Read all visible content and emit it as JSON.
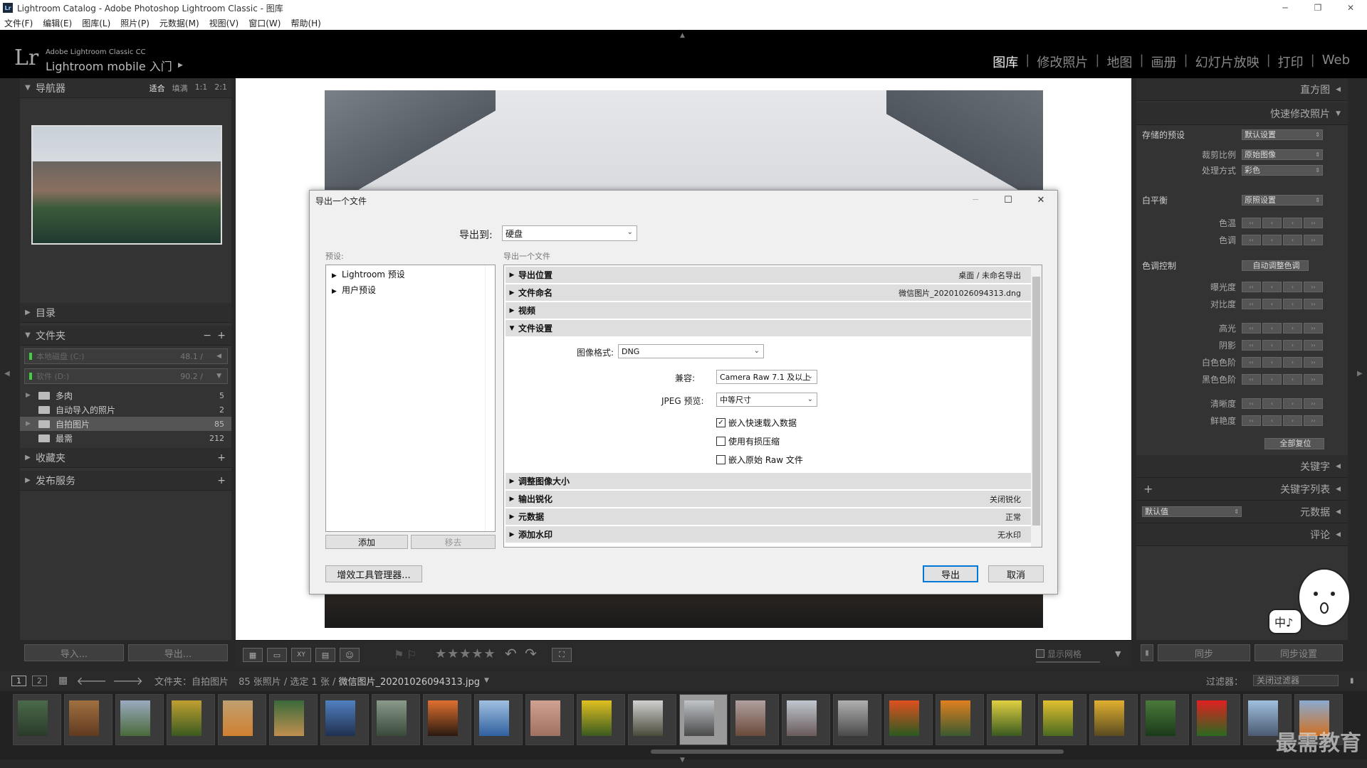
{
  "window": {
    "title": "Lightroom Catalog - Adobe Photoshop Lightroom Classic - 图库",
    "app_icon": "Lr"
  },
  "menu": [
    "文件(F)",
    "编辑(E)",
    "图库(L)",
    "照片(P)",
    "元数据(M)",
    "视图(V)",
    "窗口(W)",
    "帮助(H)"
  ],
  "identity": {
    "logo": "Lr",
    "product": "Adobe Lightroom Classic CC",
    "mobile": "Lightroom mobile 入门"
  },
  "modules": [
    "图库",
    "修改照片",
    "地图",
    "画册",
    "幻灯片放映",
    "打印",
    "Web"
  ],
  "left": {
    "navigator": {
      "title": "导航器",
      "zoom": [
        "适合",
        "填满",
        "1:1",
        "2:1"
      ]
    },
    "catalog": "目录",
    "folders": {
      "title": "文件夹",
      "volumes": [
        {
          "name": "本地磁盘 (C:)",
          "size": "48.1 /"
        },
        {
          "name": "软件 (D:)",
          "size": "90.2 /"
        }
      ],
      "items": [
        {
          "name": "多肉",
          "count": "5"
        },
        {
          "name": "自动导入的照片",
          "count": "2"
        },
        {
          "name": "自拍图片",
          "count": "85"
        },
        {
          "name": "最需",
          "count": "212"
        }
      ]
    },
    "collections": "收藏夹",
    "publish": "发布服务",
    "import_btn": "导入...",
    "export_btn": "导出..."
  },
  "dialog": {
    "title": "导出一个文件",
    "export_to_label": "导出到:",
    "export_to_value": "硬盘",
    "presets_label": "预设:",
    "section_label": "导出一个文件",
    "presets": [
      "Lightroom 预设",
      "用户预设"
    ],
    "add": "添加",
    "remove": "移去",
    "plugin_mgr": "增效工具管理器...",
    "export": "导出",
    "cancel": "取消",
    "sections": [
      {
        "name": "导出位置",
        "value": "桌面 / 未命名导出"
      },
      {
        "name": "文件命名",
        "value": "微信图片_20201026094313.dng"
      },
      {
        "name": "视频",
        "value": ""
      },
      {
        "name": "文件设置",
        "value": ""
      },
      {
        "name": "调整图像大小",
        "value": ""
      },
      {
        "name": "输出锐化",
        "value": "关闭锐化"
      },
      {
        "name": "元数据",
        "value": "正常"
      },
      {
        "name": "添加水印",
        "value": "无水印"
      }
    ],
    "file_settings": {
      "format_label": "图像格式:",
      "format": "DNG",
      "compat_label": "兼容:",
      "compat": "Camera Raw 7.1 及以上",
      "jpeg_label": "JPEG 预览:",
      "jpeg": "中等尺寸",
      "checks": [
        {
          "label": "嵌入快速载入数据",
          "checked": "✓"
        },
        {
          "label": "使用有损压缩",
          "checked": ""
        },
        {
          "label": "嵌入原始 Raw 文件",
          "checked": ""
        }
      ]
    }
  },
  "right": {
    "histogram": "直方图",
    "quick": "快速修改照片",
    "saved_preset_label": "存储的预设",
    "saved_preset": "默认设置",
    "crop_label": "裁剪比例",
    "crop": "原始图像",
    "treat_label": "处理方式",
    "treat": "彩色",
    "wb_label": "白平衡",
    "wb": "原照设置",
    "temp": "色温",
    "tint": "色调",
    "tone_label": "色调控制",
    "auto_tone": "自动调整色调",
    "tone_rows": [
      "曝光度",
      "对比度",
      "高光",
      "阴影",
      "白色色阶",
      "黑色色阶",
      "清晰度",
      "鲜艳度"
    ],
    "reset": "全部复位",
    "keywords": "关键字",
    "keyword_list": "关键字列表",
    "metadata_select": "默认值",
    "metadata": "元数据",
    "comments": "评论",
    "sync": "同步",
    "sync_settings": "同步设置"
  },
  "toolbar": {
    "show_grid": "显示网格"
  },
  "filmstrip": {
    "screen1": "1",
    "screen2": "2",
    "path": "文件夹：自拍图片",
    "count": "85 张照片 / 选定 1 张 /",
    "file": "微信图片_20201026094313.jpg",
    "filter_label": "过滤器：",
    "filter": "关闭过滤器"
  },
  "mascot_text": "中♪",
  "watermark": "最需教育"
}
